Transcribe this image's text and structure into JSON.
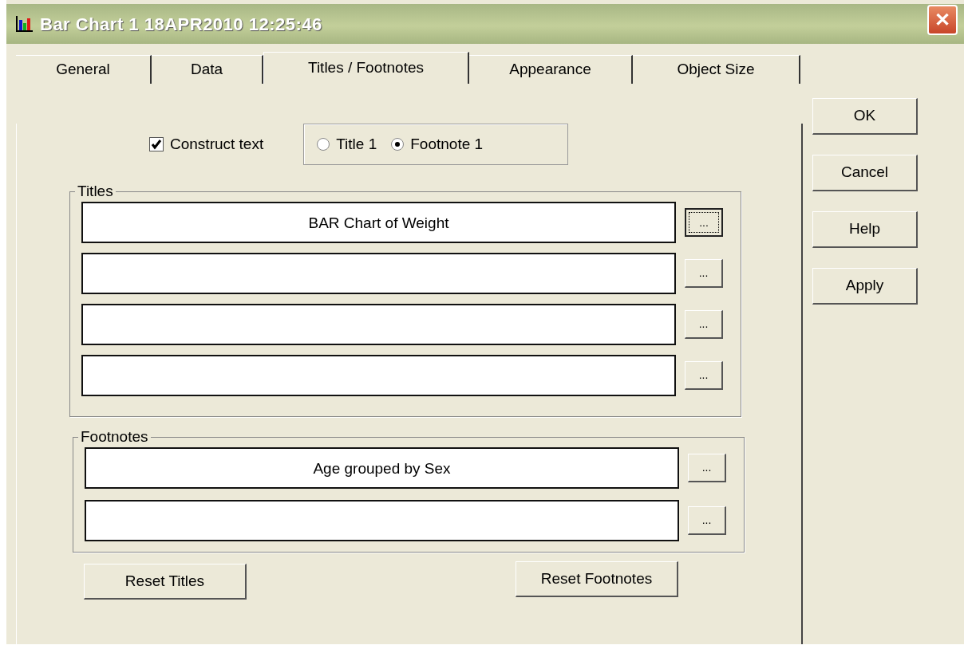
{
  "window": {
    "title": "Bar Chart 1 18APR2010 12:25:46",
    "close_label": "✕"
  },
  "tabs": [
    {
      "label": "General",
      "selected": false
    },
    {
      "label": "Data",
      "selected": false
    },
    {
      "label": "Titles / Footnotes",
      "selected": true
    },
    {
      "label": "Appearance",
      "selected": false
    },
    {
      "label": "Object Size",
      "selected": false
    }
  ],
  "construct_text": {
    "label": "Construct text",
    "checked": true
  },
  "radios": [
    {
      "label": "Title 1",
      "selected": false
    },
    {
      "label": "Footnote 1",
      "selected": true
    }
  ],
  "titles": {
    "legend": "Titles",
    "rows": [
      {
        "value": "BAR Chart of Weight",
        "button": "...",
        "focused": true
      },
      {
        "value": "",
        "button": "...",
        "focused": false
      },
      {
        "value": "",
        "button": "...",
        "focused": false
      },
      {
        "value": "",
        "button": "...",
        "focused": false
      }
    ]
  },
  "footnotes": {
    "legend": "Footnotes",
    "rows": [
      {
        "value": "Age grouped by Sex",
        "button": "...",
        "focused": false
      },
      {
        "value": "",
        "button": "...",
        "focused": false
      }
    ]
  },
  "reset_buttons": [
    "Reset Titles",
    "Reset Footnotes"
  ],
  "buttons": [
    "OK",
    "Cancel",
    "Help",
    "Apply"
  ]
}
